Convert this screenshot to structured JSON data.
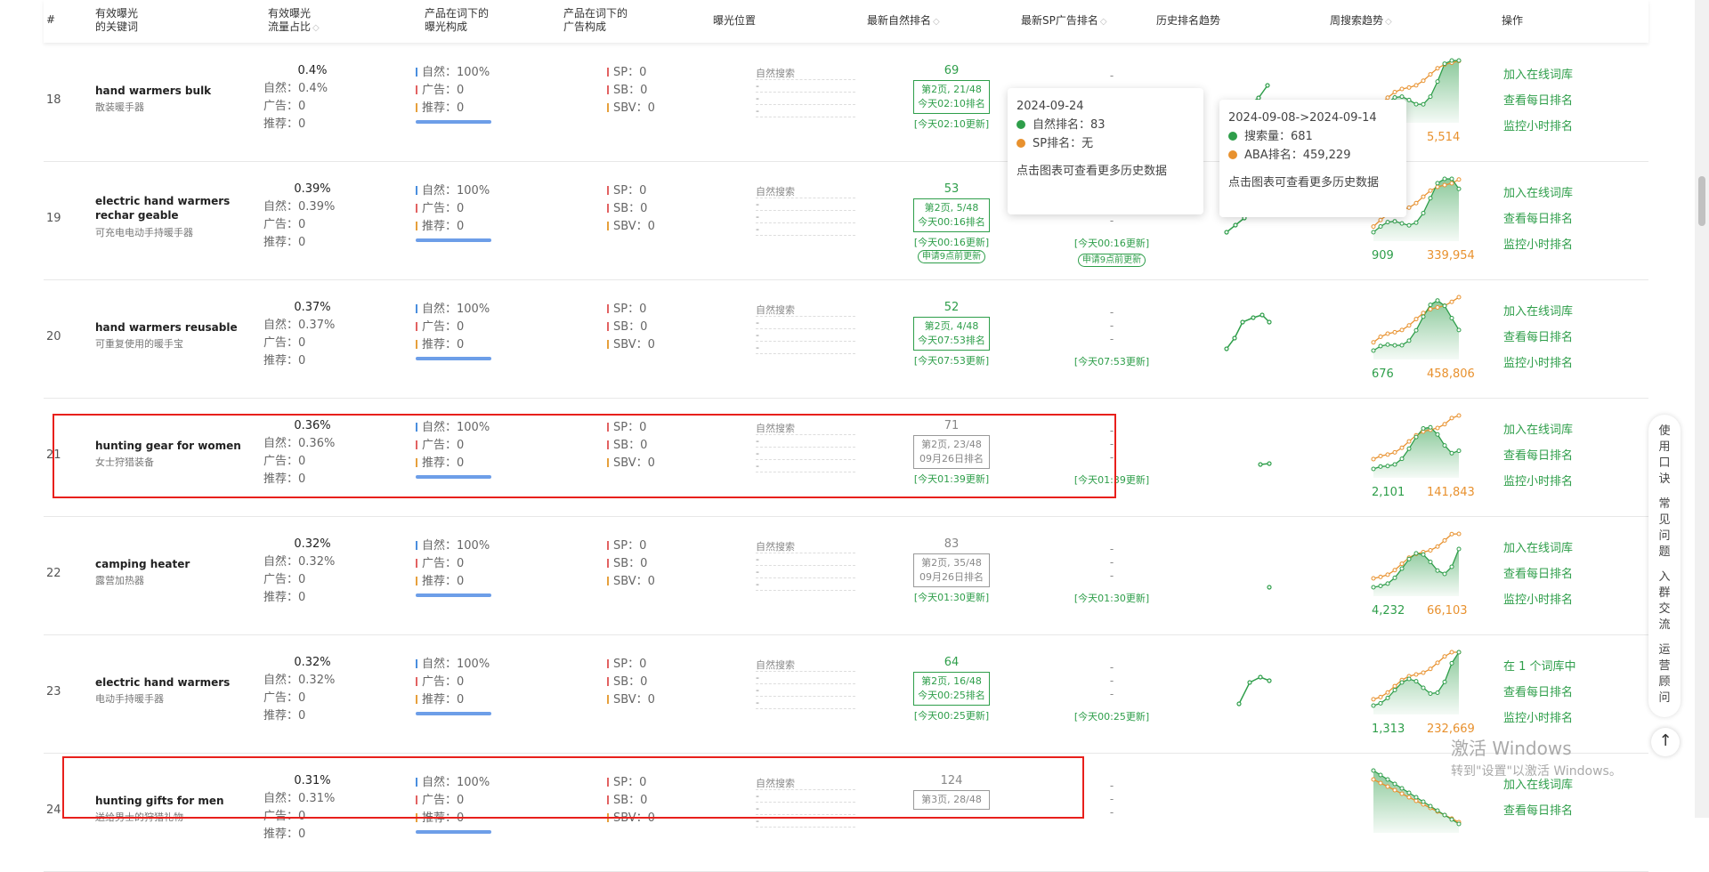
{
  "header": {
    "num": "#",
    "keyword": [
      "有效曝光",
      "的关键词"
    ],
    "share": [
      "有效曝光",
      "流量占比"
    ],
    "product_comp": [
      "产品在词下的",
      "曝光构成"
    ],
    "ad_comp": [
      "产品在词下的",
      "广告构成"
    ],
    "position": "曝光位置",
    "natural_rank": "最新自然排名",
    "sp_rank": "最新SP广告排名",
    "history": "历史排名趋势",
    "weekly": "周搜索趋势",
    "ops": "操作"
  },
  "labels": {
    "natural": "自然：",
    "ad": "广告：",
    "recommend": "推荐：",
    "sp": "SP：",
    "sb": "SB：",
    "sbv": "SBV：",
    "natural_search": "自然搜索",
    "dash": "-"
  },
  "rows": [
    {
      "num": "18",
      "en": "hand warmers bulk",
      "cn": "散装暖手器",
      "share": "0.4%",
      "nat_share": "0.4%",
      "ad": "0",
      "rec": "0",
      "comp_nat": "100%",
      "comp_ad": "0",
      "comp_rec": "0",
      "sp": "0",
      "sb": "0",
      "sbv": "0",
      "rank": "69",
      "page": "第2页, 21/48",
      "when": "今天02:10排名",
      "upd": "[今天02:10更新]",
      "sp_rank": "-",
      "sp_upd": "",
      "w_search": "",
      "w_aba": "5,514",
      "op1": "加入在线词库",
      "op2": "查看每日排名",
      "op3": "监控小时排名"
    },
    {
      "num": "19",
      "en": "electric hand warmers rechar geable",
      "cn": "可充电电动手持暖手器",
      "share": "0.39%",
      "nat_share": "0.39%",
      "ad": "0",
      "rec": "0",
      "comp_nat": "100%",
      "comp_ad": "0",
      "comp_rec": "0",
      "sp": "0",
      "sb": "0",
      "sbv": "0",
      "rank": "53",
      "page": "第2页, 5/48",
      "when": "今天00:16排名",
      "upd": "[今天00:16更新]",
      "sp_rank": "-",
      "sp_upd": "[今天00:16更新]",
      "pill": "申请9点前更新",
      "w_search": "909",
      "w_aba": "339,954",
      "op1": "加入在线词库",
      "op2": "查看每日排名",
      "op3": "监控小时排名"
    },
    {
      "num": "20",
      "en": "hand warmers reusable",
      "cn": "可重复使用的暖手宝",
      "share": "0.37%",
      "nat_share": "0.37%",
      "ad": "0",
      "rec": "0",
      "comp_nat": "100%",
      "comp_ad": "0",
      "comp_rec": "0",
      "sp": "0",
      "sb": "0",
      "sbv": "0",
      "rank": "52",
      "page": "第2页, 4/48",
      "when": "今天07:53排名",
      "upd": "[今天07:53更新]",
      "sp_rank": "-",
      "sp_upd": "[今天07:53更新]",
      "w_search": "676",
      "w_aba": "458,806",
      "op1": "加入在线词库",
      "op2": "查看每日排名",
      "op3": "监控小时排名"
    },
    {
      "num": "21",
      "en": "hunting gear for women",
      "cn": "女士狩猎装备",
      "share": "0.36%",
      "nat_share": "0.36%",
      "ad": "0",
      "rec": "0",
      "comp_nat": "100%",
      "comp_ad": "0",
      "comp_rec": "0",
      "sp": "0",
      "sb": "0",
      "sbv": "0",
      "rank": "71",
      "page": "第2页, 23/48",
      "when": "09月26日排名",
      "upd": "[今天01:39更新]",
      "sp_rank": "-",
      "sp_upd": "[今天01:39更新]",
      "w_search": "2,101",
      "w_aba": "141,843",
      "op1": "加入在线词库",
      "op2": "查看每日排名",
      "op3": "监控小时排名"
    },
    {
      "num": "22",
      "en": "camping heater",
      "cn": "露营加热器",
      "share": "0.32%",
      "nat_share": "0.32%",
      "ad": "0",
      "rec": "0",
      "comp_nat": "100%",
      "comp_ad": "0",
      "comp_rec": "0",
      "sp": "0",
      "sb": "0",
      "sbv": "0",
      "rank": "83",
      "page": "第2页, 35/48",
      "when": "09月26日排名",
      "upd": "[今天01:30更新]",
      "sp_rank": "-",
      "sp_upd": "[今天01:30更新]",
      "w_search": "4,232",
      "w_aba": "66,103",
      "op1": "加入在线词库",
      "op2": "查看每日排名",
      "op3": "监控小时排名"
    },
    {
      "num": "23",
      "en": "electric hand warmers",
      "cn": "电动手持暖手器",
      "share": "0.32%",
      "nat_share": "0.32%",
      "ad": "0",
      "rec": "0",
      "comp_nat": "100%",
      "comp_ad": "0",
      "comp_rec": "0",
      "sp": "0",
      "sb": "0",
      "sbv": "0",
      "rank": "64",
      "page": "第2页, 16/48",
      "when": "今天00:25排名",
      "upd": "[今天00:25更新]",
      "sp_rank": "-",
      "sp_upd": "[今天00:25更新]",
      "w_search": "1,313",
      "w_aba": "232,669",
      "op1": "在 1 个词库中",
      "op2": "查看每日排名",
      "op3": "监控小时排名"
    },
    {
      "num": "24",
      "en": "hunting gifts for men",
      "cn": "送给男士的狩猎礼物",
      "share": "0.31%",
      "nat_share": "0.31%",
      "ad": "0",
      "rec": "0",
      "comp_nat": "100%",
      "comp_ad": "0",
      "comp_rec": "0",
      "sp": "0",
      "sb": "0",
      "sbv": "0",
      "rank": "124",
      "page": "第3页, 28/48",
      "when": "",
      "upd": "",
      "sp_rank": "-",
      "sp_upd": "",
      "w_search": "",
      "w_aba": "",
      "op1": "加入在线词库",
      "op2": "查看每日排名",
      "op3": ""
    }
  ],
  "tooltip1": {
    "date": "2024-09-24",
    "nat": "自然排名：83",
    "sp": "SP排名：无",
    "hint": "点击图表可查看更多历史数据"
  },
  "tooltip2": {
    "date": "2024-09-08->2024-09-14",
    "search": "搜索量：681",
    "aba": "ABA排名：459,229",
    "hint": "点击图表可查看更多历史数据"
  },
  "side": {
    "item1": "使用口诀",
    "item2": "常见问题",
    "item3": "入群交流",
    "item4": "运营顾问",
    "up": "↑"
  },
  "watermark": {
    "line1": "激活 Windows",
    "line2": "转到\"设置\"以激活 Windows。"
  },
  "colors": {
    "green": "#2e9e4a",
    "orange": "#e8912e",
    "red_highlight": "#e8201c",
    "blue": "#4a8ede"
  }
}
